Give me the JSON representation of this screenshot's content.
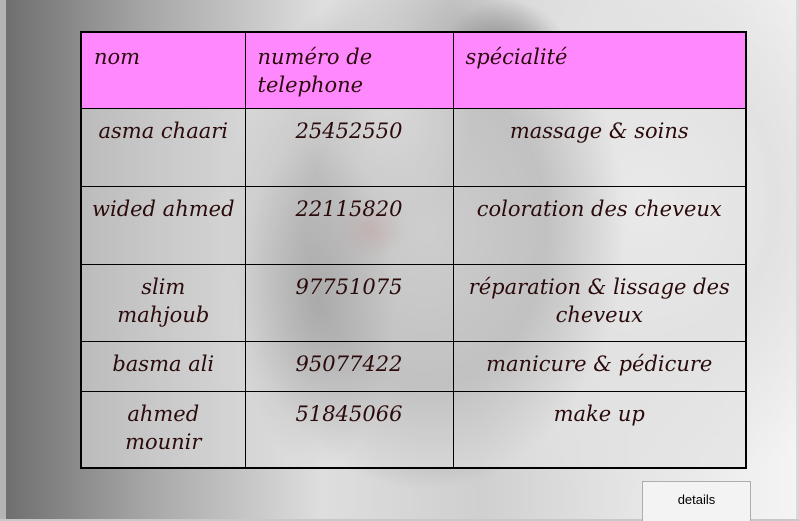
{
  "table": {
    "headers": [
      "nom",
      "numéro de telephone",
      "spécialité"
    ],
    "rows": [
      {
        "nom": "asma chaari",
        "telephone": "25452550",
        "specialite": "massage & soins"
      },
      {
        "nom": "wided ahmed",
        "telephone": "22115820",
        "specialite": "coloration des cheveux"
      },
      {
        "nom": "slim mahjoub",
        "telephone": "97751075",
        "specialite": "réparation & lissage des cheveux"
      },
      {
        "nom": "basma ali",
        "telephone": "95077422",
        "specialite": "manicure & pédicure"
      },
      {
        "nom": "ahmed mounir",
        "telephone": "51845066",
        "specialite": "make up"
      }
    ]
  },
  "buttons": {
    "details_label": "details"
  }
}
